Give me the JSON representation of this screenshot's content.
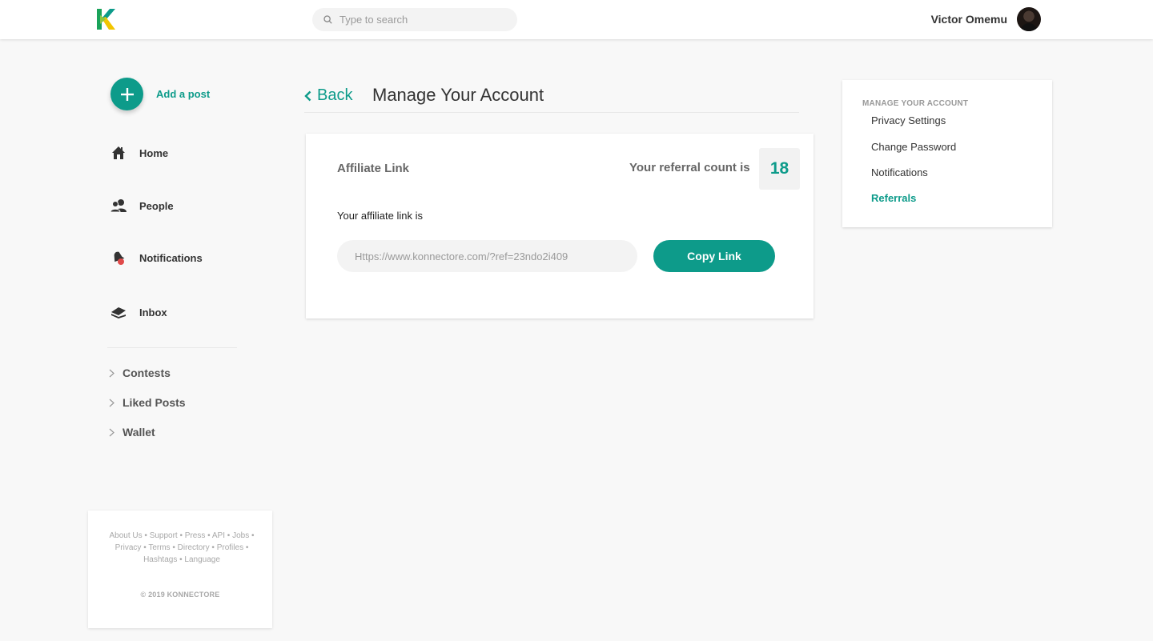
{
  "header": {
    "logo_letter": "K",
    "search_placeholder": "Type to search",
    "user_name": "Victor Omemu"
  },
  "sidebar": {
    "add_post_label": "Add a post",
    "nav": [
      {
        "label": "Home",
        "icon": "home-icon"
      },
      {
        "label": "People",
        "icon": "people-icon"
      },
      {
        "label": "Notifications",
        "icon": "notifications-icon"
      },
      {
        "label": "Inbox",
        "icon": "inbox-icon"
      }
    ],
    "sub": [
      {
        "label": "Contests"
      },
      {
        "label": "Liked Posts"
      },
      {
        "label": "Wallet"
      }
    ]
  },
  "footer": {
    "links": [
      "About Us",
      "Support",
      "Press",
      "API",
      "Jobs",
      "Privacy",
      "Terms",
      "Directory",
      "Profiles",
      "Hashtags",
      "Language"
    ],
    "separator": "•",
    "copyright": "© 2019 KONNECTORE"
  },
  "main": {
    "back_label": "Back",
    "title": "Manage Your Account",
    "card": {
      "title": "Affiliate Link",
      "referral_label": "Your referral count is",
      "referral_count": "18",
      "affiliate_label": "Your affiliate link is",
      "affiliate_link": "Https://www.konnectore.com/?ref=23ndo2i409",
      "copy_button": "Copy Link"
    }
  },
  "account_menu": {
    "heading": "MANAGE YOUR ACCOUNT",
    "items": [
      {
        "label": "Privacy Settings",
        "active": false
      },
      {
        "label": "Change Password",
        "active": false
      },
      {
        "label": "Notifications",
        "active": false
      },
      {
        "label": "Referrals",
        "active": true
      }
    ]
  },
  "colors": {
    "accent": "#0d9b8a",
    "background": "#f8f8f8",
    "card": "#ffffff"
  }
}
